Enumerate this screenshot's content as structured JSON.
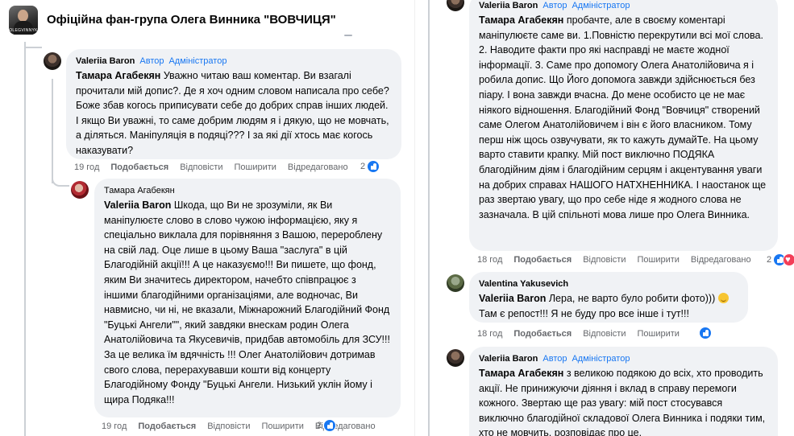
{
  "group": {
    "title": "Офіційна фан-група Олега Винника \"ВОВЧИЦЯ\"",
    "logo_text": "OLEGVINNYK"
  },
  "badges": {
    "author": "Автор",
    "admin": "Адміністратор"
  },
  "actions": {
    "like": "Подобається",
    "reply": "Відповісти",
    "share": "Поширити",
    "edited": "Відредаговано"
  },
  "left_comments": [
    {
      "author": "Valeriia Baron",
      "mention": "Тамара Агабекян",
      "text": " Уважно читаю ваш коментар. Ви взагалі прочитали мій допис?. Де я хоч одним словом написала про себе? Боже збав когось приписувати себе до добрих справ інших людей. І якщо Ви уважні, то саме добрим людям я і дякую, що не мовчать, а діляться. Маніпуляція в подяці??? І за які дії хтось має когось наказувати?",
      "time": "19 год",
      "reactions": "2"
    },
    {
      "author": "Тамара Агабекян",
      "mention": "Valeriia Baron",
      "text": " Шкода, що Ви не зрозуміли, як Ви маніпулюєте слово в слово чужою інформацією, яку я спеціально виклала для порівняння з Вашою, перероблену на свій лад. Оце лише в цьому Ваша \"заслуга\" в цій Благодійній акції!!! А це наказуємо!!! Ви пишете, що фонд, яким Ви значитесь директором, начебто співпрацює з іншими благодійними організаціями, але водночас, Ви навмисно, чи ні, не вказали, Міжнарожний Благодійний Фонд \"Буцькі Ангели\"\", який завдяки внескам родин Олега Анатолійовича та Якусевичів, придбав автомобіль для ЗСУ!!! За це велика їм вдячність !!! Олег Анатолійович дотримав свого слова, перерахувавши кошти від концерту Благодійному Фонду \"Буцькі Ангели. Низький уклін йому і щира Подяка!!!",
      "time": "19 год",
      "reactions": "2"
    }
  ],
  "right_comments": [
    {
      "author": "Valeriia Baron",
      "mention": "Тамара Агабекян",
      "text": " пробачте, але в своєму коментарі маніпулюєте саме ви. 1.Повністю перекрутили всі мої слова. 2. Наводите факти про які насправді не маєте жодної інформації. 3. Саме про допомогу Олега Анатолійовича я і робила допис. Що Його допомога завжди здійснюється без піару. І вона завжди вчасна. До мене особисто це не має ніякого відношення. Благодійний Фонд \"Вовчиця\" створений саме Олегом Анатолійовичем і він є його власником. Тому перш ніж щось озвучувати, як то кажуть думайТе. На цьому варто ставити крапку. Мій пост виключно ПОДЯКА благодійним діям і благодійним серцям і акцентування уваги на добрих справах НАШОГО НАТХНЕННИКА. І наостанок ще раз звертаю увагу, що про себе ніде я жодного слова не зазначала. В цій спільноті мова лише про Олега Винника.",
      "time": "18 год",
      "reactions": "2"
    },
    {
      "author": "Valentina Yakusevich",
      "mention": "Valeriia Baron",
      "text": " Лера, не варто було робити фото)))",
      "text2": "Там є репост!!! Я не буду про все інше і тут!!!",
      "time": "18 год"
    },
    {
      "author": "Valeriia Baron",
      "mention": "Тамара Агабекян",
      "text": " з великою подякою до всіх, хто проводить акції. Не принижуючи діяння і вклад в справу перемоги кожного. Звертаю ще раз увагу: мій пост стосувався виключно благодійної складової Олега Винника і подяки тим, хто не мовчить, розповідає про це."
    }
  ],
  "colors": {
    "bubble": "#f0f2f5",
    "link_blue": "#1877f2",
    "meta_grey": "#65676b",
    "like_blue": "#1877f2",
    "love_red": "#f33e58"
  },
  "icons": [
    "like-reaction-icon",
    "love-reaction-icon",
    "smiley-emoji-icon"
  ]
}
